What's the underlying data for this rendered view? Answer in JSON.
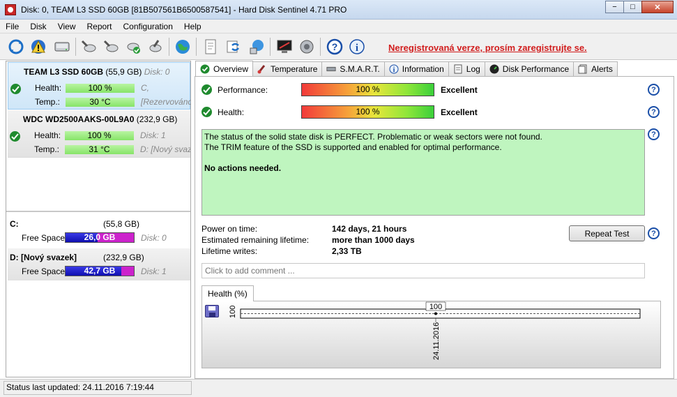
{
  "window": {
    "title": "Disk: 0, TEAM L3 SSD 60GB [81B507561B6500587541]  -  Hard Disk Sentinel 4.71 PRO",
    "minimize": "−",
    "maximize": "□",
    "close": "✕"
  },
  "menu": [
    "File",
    "Disk",
    "View",
    "Report",
    "Configuration",
    "Help"
  ],
  "toolbar": {
    "icons": [
      "refresh-icon",
      "warning-icon",
      "disk-icon",
      "disk-tools-icon-1",
      "disk-tools-icon-2",
      "disk-check-icon",
      "disk-tools-icon-3",
      "globe-icon",
      "report-icon",
      "sync-icon",
      "network-icon",
      "monitor-icon",
      "sound-icon",
      "help-icon",
      "info-icon"
    ],
    "unregistered": "Neregistrovaná verze, prosím zaregistrujte se."
  },
  "disks": [
    {
      "name": "TEAM L3 SSD 60GB",
      "size": "(55,9 GB)",
      "disk": "Disk: 0",
      "health_label": "Health:",
      "health": "100 %",
      "temp_label": "Temp.:",
      "temp": "30 °C",
      "drive": "C,",
      "volume": "[Rezervováno"
    },
    {
      "name": "WDC WD2500AAKS-00L9A0",
      "size": "(232,9 GB)",
      "disk": "",
      "health_label": "Health:",
      "health": "100 %",
      "temp_label": "Temp.:",
      "temp": "31 °C",
      "drive": "Disk: 1",
      "volume": "D: [Nový svaz"
    }
  ],
  "volumes": [
    {
      "name": "C:",
      "size": "(55,8 GB)",
      "free_label": "Free Space",
      "free": "26,0 GB",
      "disk": "Disk: 0",
      "used_fraction": 0.466
    },
    {
      "name": "D: [Nový svazek]",
      "size": "(232,9 GB)",
      "free_label": "Free Space",
      "free": "42,7 GB",
      "disk": "Disk: 1",
      "used_fraction": 0.817
    }
  ],
  "tabs": [
    {
      "label": "Overview",
      "icon": "check-icon"
    },
    {
      "label": "Temperature",
      "icon": "thermometer-icon"
    },
    {
      "label": "S.M.A.R.T.",
      "icon": "chip-icon"
    },
    {
      "label": "Information",
      "icon": "info-icon"
    },
    {
      "label": "Log",
      "icon": "log-icon"
    },
    {
      "label": "Disk Performance",
      "icon": "gauge-icon"
    },
    {
      "label": "Alerts",
      "icon": "alerts-icon"
    }
  ],
  "overview": {
    "performance_label": "Performance:",
    "performance_value": "100 %",
    "performance_rating": "Excellent",
    "health_label": "Health:",
    "health_value": "100 %",
    "health_rating": "Excellent",
    "status_line1": "The status of the solid state disk is PERFECT. Problematic or weak sectors were not found.",
    "status_line2": "The TRIM feature of the SSD is supported and enabled for optimal performance.",
    "status_line3": "No actions needed.",
    "power_on_label": "Power on time:",
    "power_on_value": "142 days, 21 hours",
    "remaining_label": "Estimated remaining lifetime:",
    "remaining_value": "more than 1000 days",
    "writes_label": "Lifetime writes:",
    "writes_value": "2,33 TB",
    "repeat_test": "Repeat Test",
    "comment_placeholder": "Click to add comment ...",
    "health_tab": "Health (%)"
  },
  "chart_data": {
    "type": "line",
    "title": "",
    "x": [
      "24.11.2016"
    ],
    "series": [
      {
        "values": [
          100
        ]
      }
    ],
    "ylabel": "",
    "ytick": "100",
    "point_label": "100"
  },
  "statusbar": {
    "text": "Status last updated: 24.11.2016 7:19:44"
  },
  "colors": {
    "unregistered": "#d11d1d",
    "status_box": "#bff5bf",
    "health_bar": "#86e468",
    "free_space_used": "#0f0fb0",
    "free_space_free": "#cc22cc"
  }
}
